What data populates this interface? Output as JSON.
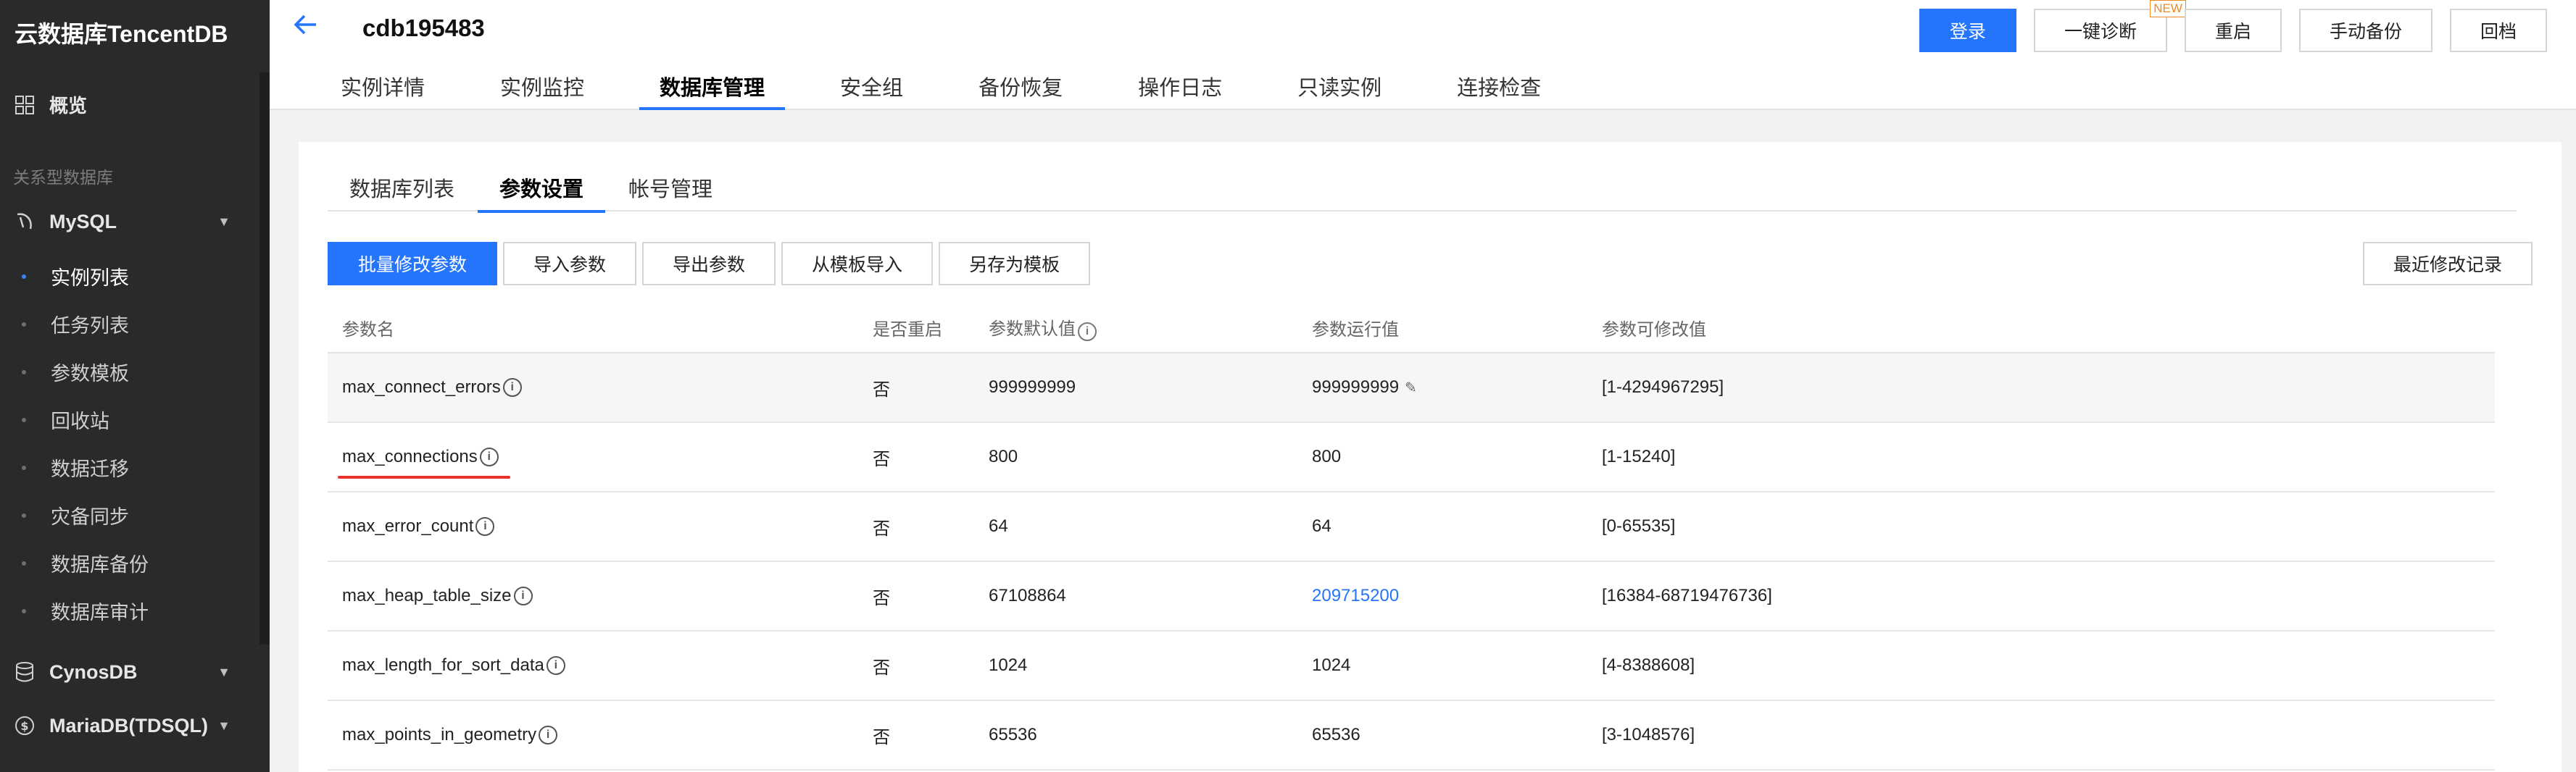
{
  "sidebar": {
    "brand": "云数据库TencentDB",
    "overview_label": "概览",
    "section_label": "关系型数据库",
    "mysql_label": "MySQL",
    "sub_items": [
      "实例列表",
      "任务列表",
      "参数模板",
      "回收站",
      "数据迁移",
      "灾备同步",
      "数据库备份",
      "数据库审计"
    ],
    "active_sub": "实例列表",
    "cynosdb_label": "CynosDB",
    "mariadb_label": "MariaDB(TDSQL)"
  },
  "header": {
    "instance_id": "cdb195483",
    "tabs": [
      "实例详情",
      "实例监控",
      "数据库管理",
      "安全组",
      "备份恢复",
      "操作日志",
      "只读实例",
      "连接检查"
    ],
    "active_tab": "数据库管理",
    "buttons": {
      "login": "登录",
      "diagnose": "一键诊断",
      "diagnose_badge": "NEW",
      "restart": "重启",
      "manual_backup": "手动备份",
      "rollback": "回档"
    }
  },
  "subtabs": [
    "数据库列表",
    "参数设置",
    "帐号管理"
  ],
  "active_subtab": "参数设置",
  "toolbar": {
    "batch_modify": "批量修改参数",
    "import_params": "导入参数",
    "export_params": "导出参数",
    "import_from_template": "从模板导入",
    "save_as_template": "另存为模板",
    "recent_changes": "最近修改记录"
  },
  "table": {
    "headers": [
      "参数名",
      "是否重启",
      "参数默认值",
      "参数运行值",
      "参数可修改值"
    ],
    "rows": [
      {
        "name": "max_connect_errors",
        "restart": "否",
        "default": "999999999",
        "running": "999999999",
        "range": "[1-4294967295]"
      },
      {
        "name": "max_connections",
        "restart": "否",
        "default": "800",
        "running": "800",
        "range": "[1-15240]"
      },
      {
        "name": "max_error_count",
        "restart": "否",
        "default": "64",
        "running": "64",
        "range": "[0-65535]"
      },
      {
        "name": "max_heap_table_size",
        "restart": "否",
        "default": "67108864",
        "running": "209715200",
        "range": "[16384-68719476736]"
      },
      {
        "name": "max_length_for_sort_data",
        "restart": "否",
        "default": "1024",
        "running": "1024",
        "range": "[4-8388608]"
      },
      {
        "name": "max_points_in_geometry",
        "restart": "否",
        "default": "65536",
        "running": "65536",
        "range": "[3-1048576]"
      }
    ]
  },
  "colors": {
    "primary": "#2475fc",
    "sidebar_bg": "#292a2b",
    "highlight_underline": "#e8312a",
    "new_badge": "#f08a24"
  }
}
